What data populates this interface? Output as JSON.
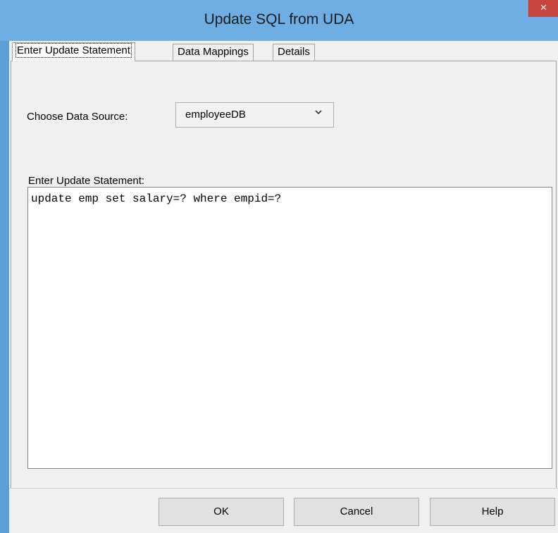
{
  "window": {
    "title": "Update SQL from UDA",
    "close_glyph": "×"
  },
  "tabs": [
    {
      "label": "Enter Update Statement",
      "active": true
    },
    {
      "label": "Data Mappings",
      "active": false
    },
    {
      "label": "Details",
      "active": false
    }
  ],
  "data_source": {
    "label": "Choose Data Source:",
    "selected": "employeeDB",
    "arrow_icon": "chevron-down-icon"
  },
  "statement": {
    "label": "Enter Update Statement:",
    "value": "update emp set salary=? where empid=?"
  },
  "buttons": {
    "ok": "OK",
    "cancel": "Cancel",
    "help": "Help"
  }
}
